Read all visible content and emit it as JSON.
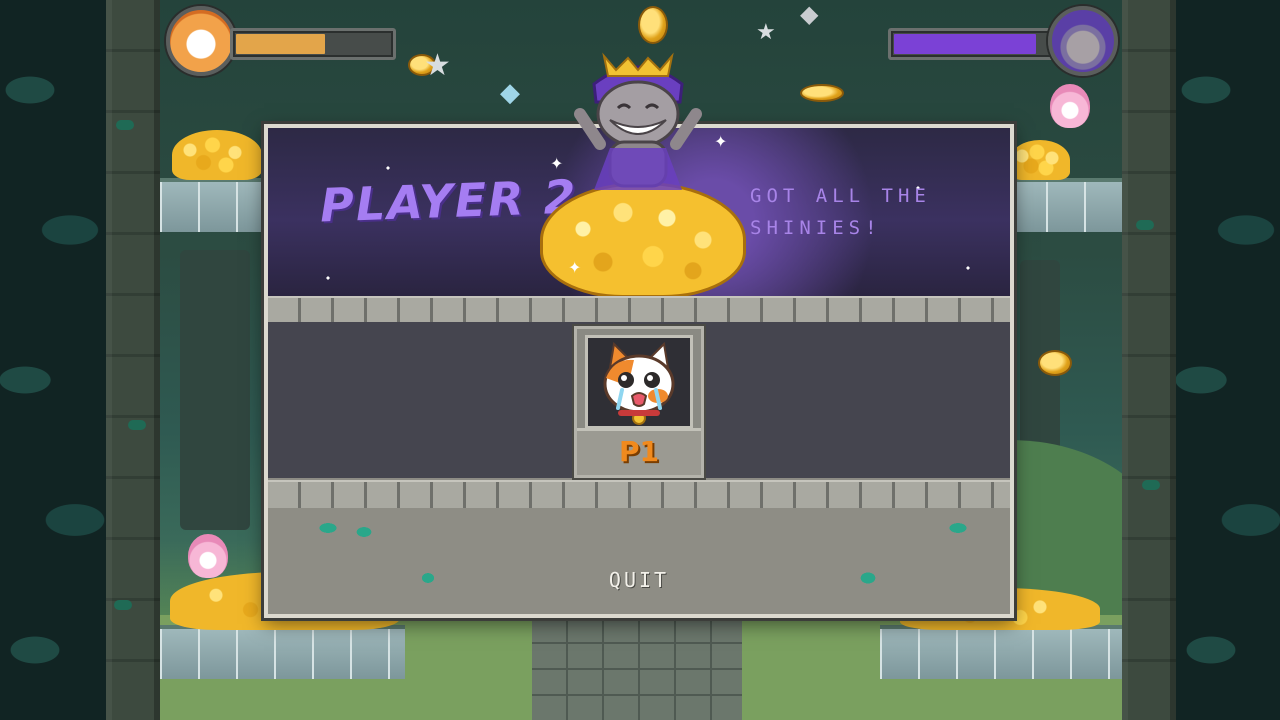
{
  "result": {
    "winner_title": "PLAYER 2",
    "winner_subtitle": "GOT ALL THE SHINIES!",
    "loser_label": "P1"
  },
  "menu": {
    "quit_label": "QUIT"
  },
  "hud": {
    "player1_health_fraction": 0.6,
    "player2_health_fraction": 0.96
  },
  "colors": {
    "player1_accent": "#f08a1e",
    "player2_accent": "#a57df2",
    "p1_bar": "#e3a54a",
    "p2_bar": "#7b41d6"
  },
  "icons": {
    "player1_avatar": "calico-cat-avatar-icon",
    "player2_avatar": "tabby-cat-purple-hood-avatar-icon",
    "loser_portrait": "crying-calico-cat-icon",
    "winner_character": "grinning-tabby-cat-on-gold-icon"
  }
}
